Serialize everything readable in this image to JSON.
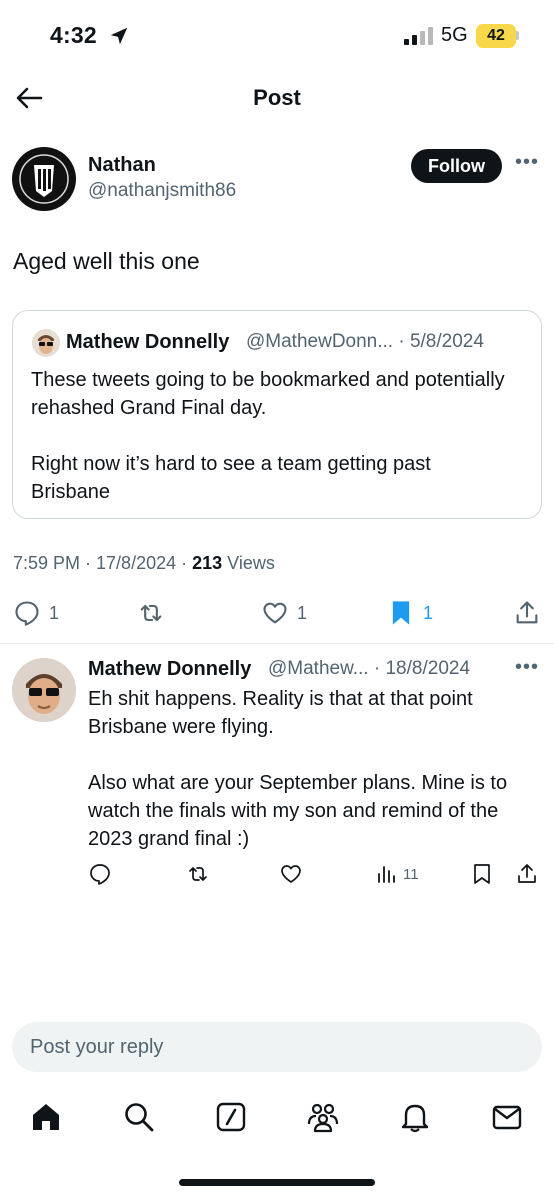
{
  "status_bar": {
    "time": "4:32",
    "network": "5G",
    "battery": "42"
  },
  "header": {
    "title": "Post"
  },
  "post": {
    "author_name": "Nathan",
    "author_handle": "@nathanjsmith86",
    "follow_label": "Follow",
    "text": "Aged well this one",
    "quote": {
      "author_name": "Mathew Donnelly",
      "handle_date": "@MathewDonn... · 5/8/2024",
      "text": "These tweets going to be bookmarked and potentially rehashed Grand Final day.\n\nRight now it’s hard to see a team getting past Brisbane"
    },
    "meta_time": "7:59 PM · 17/8/2024 · ",
    "meta_views_count": "213",
    "meta_views_label": " Views",
    "counts": {
      "replies": "1",
      "likes": "1",
      "bookmarks": "1"
    }
  },
  "reply": {
    "author_name": "Mathew Donnelly",
    "handle_date": "@Mathew... · 18/8/2024",
    "text": "Eh shit happens. Reality is that at that point Brisbane were flying.\n\nAlso what are your September plans. Mine is to watch the finals with my son and remind of the 2023 grand final :)",
    "views": "11"
  },
  "reply_input": {
    "placeholder": "Post your reply"
  },
  "colors": {
    "bookmark_active": "#1d9bf0",
    "battery": "#f6d84a"
  },
  "icons": [
    "location-arrow-icon",
    "signal-icon",
    "back-arrow-icon",
    "more-icon",
    "reply-icon",
    "repost-icon",
    "like-icon",
    "bookmark-icon",
    "share-icon",
    "views-icon",
    "home-icon",
    "search-icon",
    "grok-icon",
    "communities-icon",
    "notifications-icon",
    "messages-icon"
  ]
}
